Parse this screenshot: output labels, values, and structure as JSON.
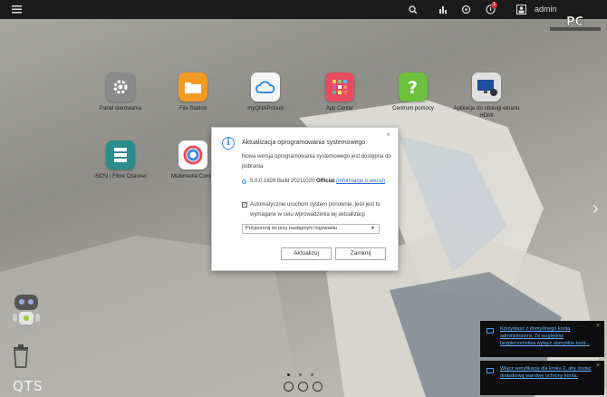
{
  "topbar": {
    "user": "admin",
    "notification_count": "1",
    "watermark_text": "PC"
  },
  "desktop": {
    "apps": [
      {
        "label": "Panel sterowania",
        "icon": "gear-icon",
        "color": "#8a8a8a"
      },
      {
        "label": "File Station",
        "icon": "folder-icon",
        "color": "#f39a22"
      },
      {
        "label": "myQNAPcloud",
        "icon": "cloud-icon",
        "color": "#f4f4f4"
      },
      {
        "label": "App Center",
        "icon": "grid-icon",
        "color": "#e84a5f"
      },
      {
        "label": "Centrum pomocy",
        "icon": "question-icon",
        "color": "#6cc03c"
      },
      {
        "label": "Aplikacje do obsługi ekranu HDMI",
        "icon": "monitor-icon",
        "color": "#e0e0e0"
      },
      {
        "label": "iSCSI i Fibre Channel",
        "icon": "storage-icon",
        "color": "#2a8c8c"
      },
      {
        "label": "Multimedia Conso",
        "icon": "multimedia-icon",
        "color": "#ffffff"
      }
    ]
  },
  "modal": {
    "title": "Aktualizacja oprogramowania systemowego",
    "description": "Nowa wersja oprogramowania systemowego jest dostępna do pobrania",
    "version_text": "5.0.0.1828 Build 20211020",
    "version_tag": "Official",
    "version_link": "(Informacje o wersji)",
    "auto_restart_text": "Automatycznie uruchom system ponownie, jeśli jest to wymagane w celu wprowadzenia tej aktualizacji",
    "auto_restart_checked": "✓",
    "reminder_select": "Przypomnij mi przy następnym logowaniu",
    "update_button": "Aktualizuj",
    "close_button": "Zamknij",
    "close_x": "×"
  },
  "notifications": [
    {
      "text": "Korzystasz z domyślnego konta administratora. Ze względów bezpieczeństwa wyłącz domyślne kont..."
    },
    {
      "text": "Włącz weryfikację dla kroku 2, aby dodać dodatkową warstwę ochrony konta."
    }
  ],
  "footer": {
    "brand": "QTS"
  },
  "colors": {
    "accent": "#3a8de0",
    "topbar": "#1b1b1b",
    "notification_bg": "#0e0e0e"
  }
}
